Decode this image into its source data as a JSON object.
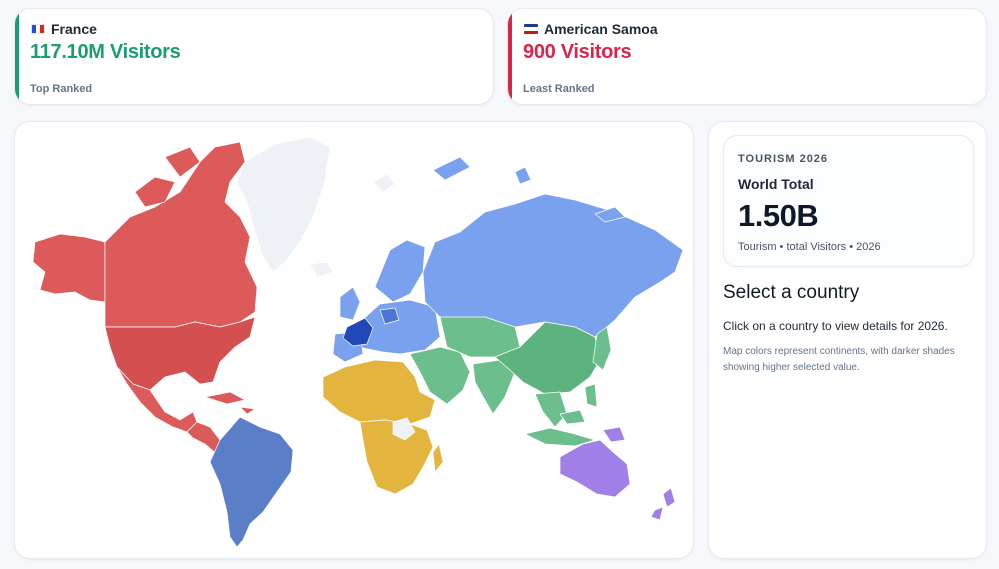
{
  "top_stat": {
    "country": "France",
    "flag": "flag-france-icon",
    "value": "117.10M Visitors",
    "label": "Top Ranked",
    "color": "#1a9e6e"
  },
  "least_stat": {
    "country": "American Samoa",
    "flag": "flag-american-samoa-icon",
    "value": "900 Visitors",
    "label": "Least Ranked",
    "color": "#d7264b"
  },
  "map": {
    "continent_colors": {
      "north_america": "#dc5a5a",
      "greenland": "#eef2f6",
      "south_america": "#5a7fc8",
      "europe": "#7aa1ee",
      "asia_north": "#7aa1ee",
      "asia": "#6cbf8c",
      "africa": "#e3b53e",
      "oceania": "#a07fe6",
      "highlight": "#2147b8"
    }
  },
  "summary": {
    "tag": "TOURISM 2026",
    "title": "World Total",
    "value": "1.50B",
    "meta": "Tourism • total Visitors • 2026"
  },
  "panel": {
    "heading": "Select a country",
    "description": "Click on a country to view details for 2026.",
    "note": "Map colors represent continents, with darker shades showing higher selected value."
  }
}
